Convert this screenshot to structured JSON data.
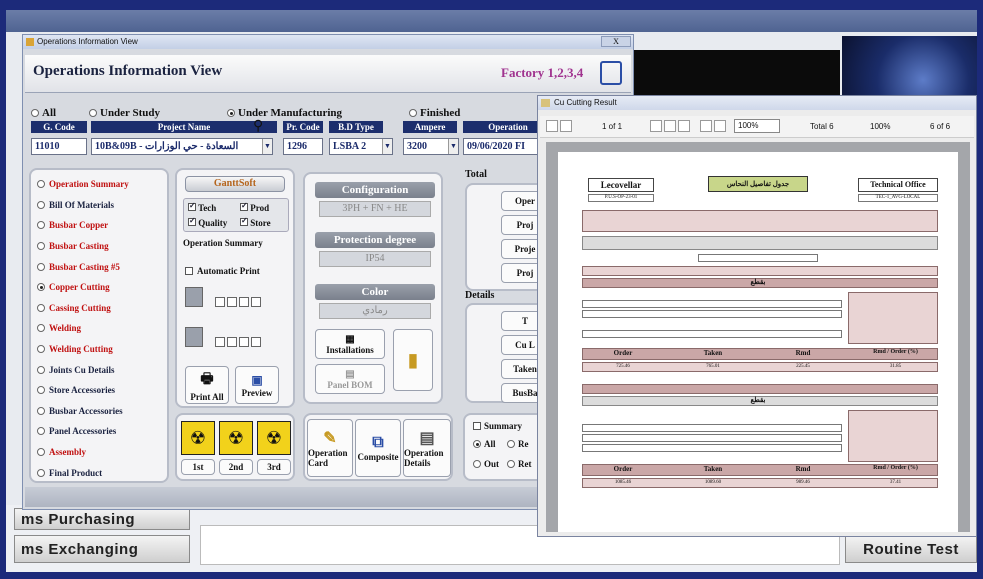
{
  "background_app": {
    "buttons": [
      "ms Purchasing",
      "ms Exchanging",
      "Routine Test"
    ]
  },
  "ops_window": {
    "window_title": "Operations Information View",
    "close_label": "X",
    "title": "Operations Information View",
    "factory": "Factory 1,2,3,4",
    "filters": [
      {
        "label": "All",
        "selected": false
      },
      {
        "label": "Under Study",
        "selected": false
      },
      {
        "label": "Under Manufacturing",
        "selected": true
      },
      {
        "label": "Finished",
        "selected": false
      }
    ],
    "columns": [
      "G. Code",
      "Project Name",
      "Pr. Code",
      "B.D Type",
      "Ampere",
      "Operation"
    ],
    "row": {
      "g_code": "11010",
      "project_name": "10B&09B - السعادة - حي الوزارات",
      "pr_code": "1296",
      "bd_type": "LSBA 2",
      "ampere": "3200",
      "operation_date": "09/06/2020 FI"
    },
    "nav_items": [
      {
        "label": "Operation Summary",
        "style": "red",
        "selected": false
      },
      {
        "label": "Bill Of Materials",
        "style": "dark",
        "selected": false
      },
      {
        "label": "Busbar Copper",
        "style": "red",
        "selected": false
      },
      {
        "label": "Busbar Casting",
        "style": "red",
        "selected": false
      },
      {
        "label": "Busbar Casting #5",
        "style": "red",
        "selected": false
      },
      {
        "label": "Copper Cutting",
        "style": "red",
        "selected": true
      },
      {
        "label": "Cassing Cutting",
        "style": "red",
        "selected": false
      },
      {
        "label": "Welding",
        "style": "red",
        "selected": false
      },
      {
        "label": "Welding Cutting",
        "style": "red",
        "selected": false
      },
      {
        "label": "Joints Cu Details",
        "style": "dark",
        "selected": false
      },
      {
        "label": "Store Accessories",
        "style": "dark",
        "selected": false
      },
      {
        "label": "Busbar Accessories",
        "style": "dark",
        "selected": false
      },
      {
        "label": "Panel Accessories",
        "style": "dark",
        "selected": false
      },
      {
        "label": "Assembly",
        "style": "red",
        "selected": false
      },
      {
        "label": "Final Product",
        "style": "dark",
        "selected": false
      }
    ],
    "ganttbutton": "GanttSoft",
    "checks": [
      {
        "label": "Tech",
        "checked": true
      },
      {
        "label": "Prod",
        "checked": true
      },
      {
        "label": "Quality",
        "checked": true
      },
      {
        "label": "Store",
        "checked": true
      }
    ],
    "operation_summary_label": "Operation Summary",
    "automatic_print_label": "Automatic Print",
    "print_all_label": "Print All",
    "preview_label": "Preview",
    "stage_labels": [
      "1st",
      "2nd",
      "3rd"
    ],
    "configuration": {
      "header": "Configuration",
      "value": "3PH + FN + HE"
    },
    "protection": {
      "header": "Protection degree",
      "value": "IP54"
    },
    "color": {
      "header": "Color",
      "value": "رمادي"
    },
    "installations_label": "Installations",
    "panel_bom_label": "Panel BOM",
    "bottom_buttons": [
      "Operation Card",
      "Composite",
      "Operation Details"
    ],
    "total_label": "Total",
    "total_items": [
      "Oper",
      "Proj",
      "Proje",
      "Proj"
    ],
    "details_label": "Details",
    "detail_items": [
      "T",
      "Cu L",
      "Taken",
      "BusBa"
    ],
    "summary_label": "Summary",
    "summary_radios": [
      "All",
      "Re",
      "Out",
      "Ret"
    ]
  },
  "cu_window": {
    "window_title": "Cu Cutting Result",
    "page_text": "1 of 1",
    "zoom": "100%",
    "total_text": "Total 6",
    "total_value": "100%",
    "count_text": "6 of 6",
    "report": {
      "left_header": "Lecovellar",
      "left_sub": "P.U.S-OP-23-01",
      "center_header": "جدول تفاصيل النحاس",
      "right_header": "Technical Office",
      "right_sub": "TEC-1_AVG-LOCAL",
      "section_label_1": "بقطع",
      "section_label_2": "بقطع",
      "footer_headers": [
        "Order",
        "Taken",
        "Rmd",
        "Rmd / Order (%)"
      ],
      "footer_values_1": [
        "725.46",
        "765.01",
        "225.45",
        "31.85"
      ],
      "footer_values_2": [
        "1085.46",
        "1089.60",
        "989.46",
        "37.41"
      ]
    }
  }
}
